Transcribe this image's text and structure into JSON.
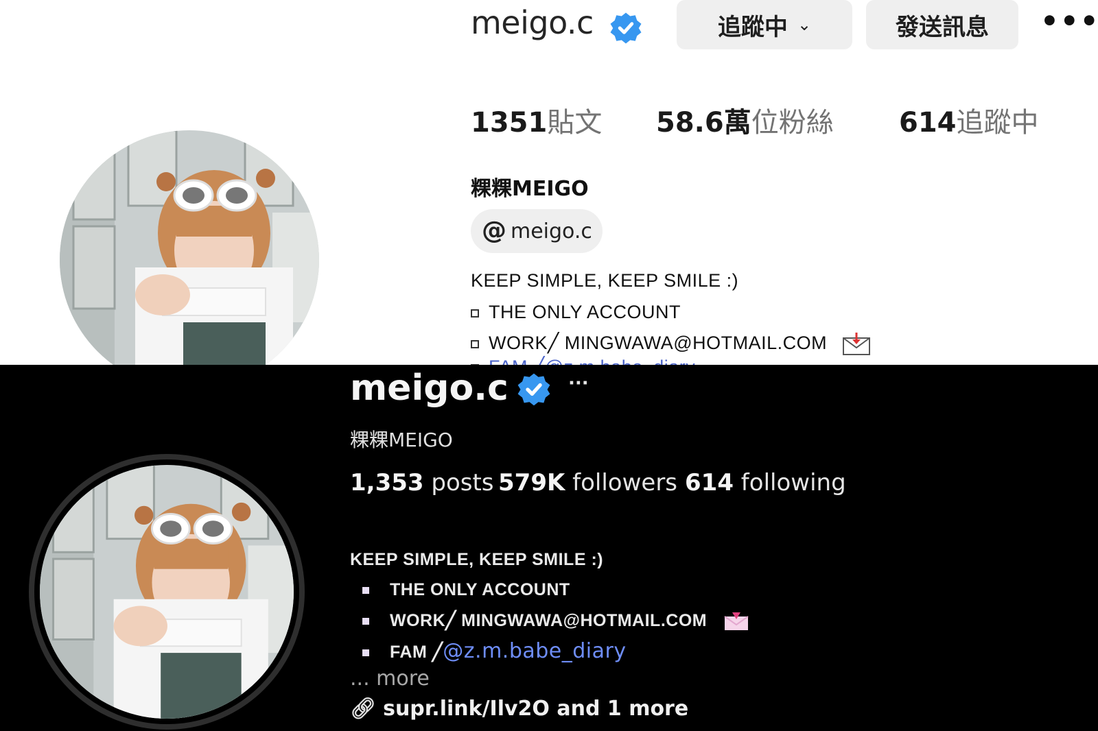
{
  "top_panel": {
    "username": "meigo.c",
    "follow_button": "追蹤中",
    "message_button": "發送訊息",
    "more_icon": "•••",
    "stats": {
      "posts_count": "1351",
      "posts_label": "貼文",
      "followers_count": "58.6萬",
      "followers_label": "位粉絲",
      "following_count": "614",
      "following_label": "追蹤中"
    },
    "display_name": "粿粿MEIGO",
    "threads_handle": "meigo.c",
    "bio": {
      "line1": "KEEP SIMPLE, KEEP SMILE :)",
      "line2": "THE ONLY ACCOUNT",
      "line3": "WORK╱ MINGWAWA@HOTMAIL.COM",
      "line4_partial": "FAM ╱@z.m.babe_diary"
    }
  },
  "bottom_panel": {
    "username": "meigo.c",
    "more_icon": "···",
    "display_name": "粿粿MEIGO",
    "stats": {
      "posts_count": "1,353",
      "posts_label": "posts",
      "followers_count": "579K",
      "followers_label": "followers",
      "following_count": "614",
      "following_label": "following"
    },
    "bio": {
      "line1": "KEEP SIMPLE, KEEP SMILE :)",
      "line2": "THE ONLY ACCOUNT",
      "line3": "WORK╱ MINGWAWA@HOTMAIL.COM",
      "line4_prefix": "FAM ╱",
      "line4_link": "@z.m.babe_diary"
    },
    "more_text": "... more",
    "external_link": "supr.link/Ilv2O and 1 more"
  },
  "colors": {
    "verified_blue": "#3797f0",
    "link_blue_light": "#4b64c9",
    "link_blue_dark": "#6e8df7"
  }
}
